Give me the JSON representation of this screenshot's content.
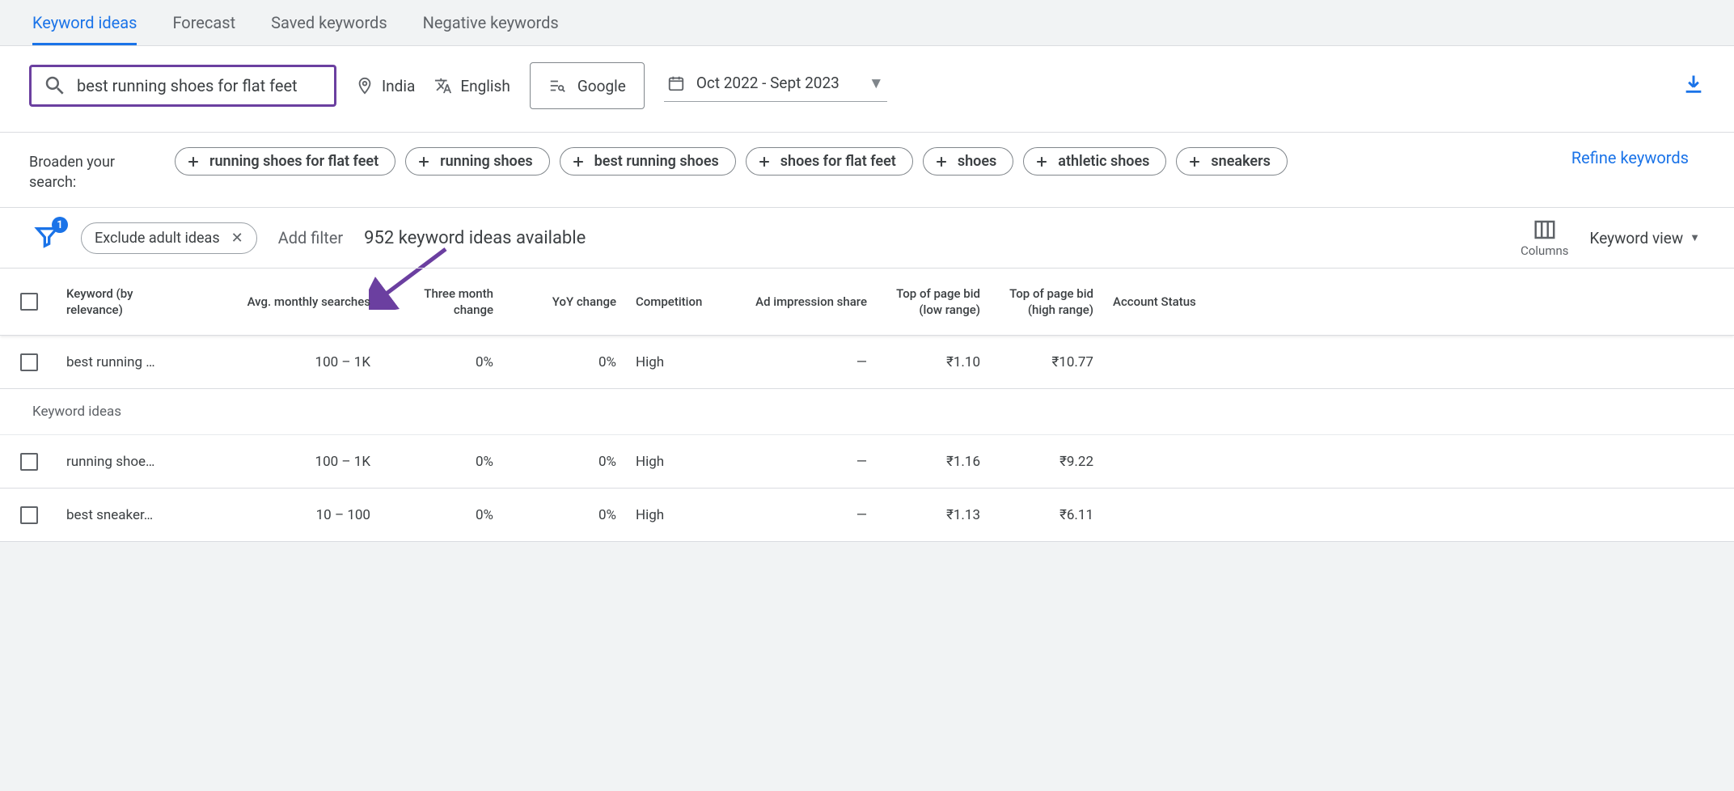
{
  "tabs": [
    {
      "label": "Keyword ideas",
      "active": true
    },
    {
      "label": "Forecast",
      "active": false
    },
    {
      "label": "Saved keywords",
      "active": false
    },
    {
      "label": "Negative keywords",
      "active": false
    }
  ],
  "search": {
    "value": "best running shoes for flat feet"
  },
  "location": {
    "label": "India"
  },
  "language": {
    "label": "English"
  },
  "network": {
    "label": "Google"
  },
  "dateRange": {
    "label": "Oct 2022 - Sept 2023"
  },
  "broaden": {
    "label": "Broaden your search:",
    "chips": [
      "running shoes for flat feet",
      "running shoes",
      "best running shoes",
      "shoes for flat feet",
      "shoes",
      "athletic shoes",
      "sneakers"
    ]
  },
  "refine": {
    "label": "Refine keywords"
  },
  "filters": {
    "badge": "1",
    "exclude": "Exclude adult ideas",
    "addFilter": "Add filter",
    "countText": "952 keyword ideas available",
    "columns": "Columns",
    "view": "Keyword view"
  },
  "columns": {
    "c1": "Keyword (by relevance)",
    "c2": "Avg. monthly searches",
    "c3": "Three month change",
    "c4": "YoY change",
    "c5": "Competition",
    "c6": "Ad impression share",
    "c7": "Top of page bid (low range)",
    "c8": "Top of page bid (high range)",
    "c9": "Account Status"
  },
  "sectionLabel": "Keyword ideas",
  "rows": [
    {
      "kw": "best running …",
      "avg": "100 – 1K",
      "m3": "0%",
      "yoy": "0%",
      "comp": "High",
      "imp": "—",
      "low": "₹1.10",
      "high": "₹10.77",
      "acc": ""
    },
    {
      "kw": "running shoe…",
      "avg": "100 – 1K",
      "m3": "0%",
      "yoy": "0%",
      "comp": "High",
      "imp": "—",
      "low": "₹1.16",
      "high": "₹9.22",
      "acc": ""
    },
    {
      "kw": "best sneaker…",
      "avg": "10 – 100",
      "m3": "0%",
      "yoy": "0%",
      "comp": "High",
      "imp": "—",
      "low": "₹1.13",
      "high": "₹6.11",
      "acc": ""
    }
  ]
}
